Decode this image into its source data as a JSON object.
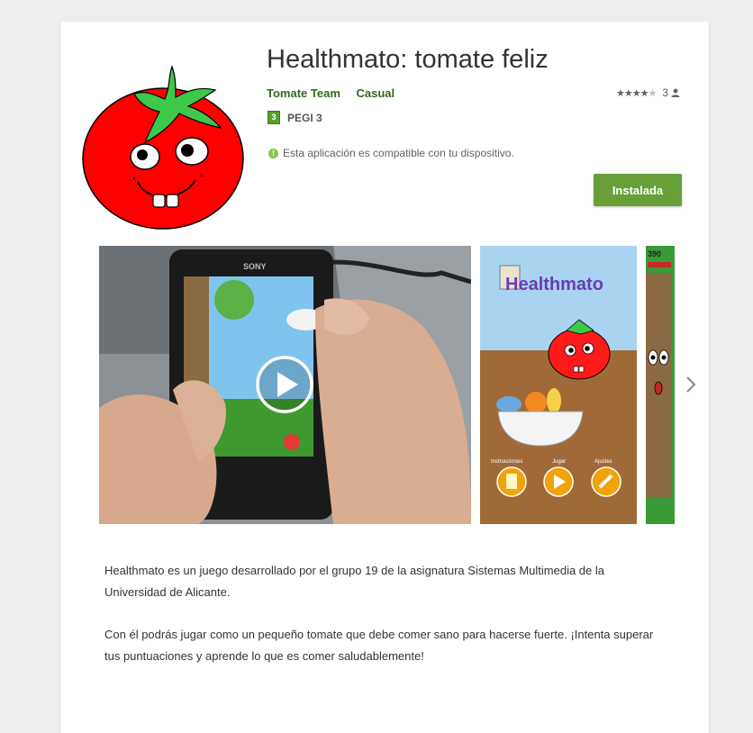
{
  "app": {
    "title": "Healthmato: tomate feliz",
    "developer": "Tomate Team",
    "category": "Casual",
    "rating_count": "3",
    "rating_value": 4.5,
    "content_rating_badge": "3",
    "content_rating": "PEGI 3",
    "compatibility": "Esta aplicación es compatible con tu dispositivo.",
    "install_label": "Instalada"
  },
  "media": {
    "video_brand": "SONY",
    "shot1_logo": "Healthmato",
    "shot1_menu": [
      "Instrucciones",
      "Jugar",
      "Ajustes"
    ],
    "shot2_score": "390"
  },
  "description": {
    "paragraph1": "Healthmato es un juego desarrollado por el grupo 19 de la asignatura Sistemas Multimedia de la Universidad de Alicante.",
    "paragraph2": "Con él podrás jugar como un pequeño tomate que debe comer sano para hacerse fuerte. ¡Intenta superar tus puntuaciones y aprende lo que es comer saludablemente!"
  },
  "colors": {
    "accent_green": "#33691e",
    "install_button": "#689f38",
    "page_background": "#eeeeee"
  },
  "icons": [
    "tomato-logo",
    "star-icon",
    "person-icon",
    "info-icon",
    "play-icon",
    "chevron-right-icon"
  ]
}
